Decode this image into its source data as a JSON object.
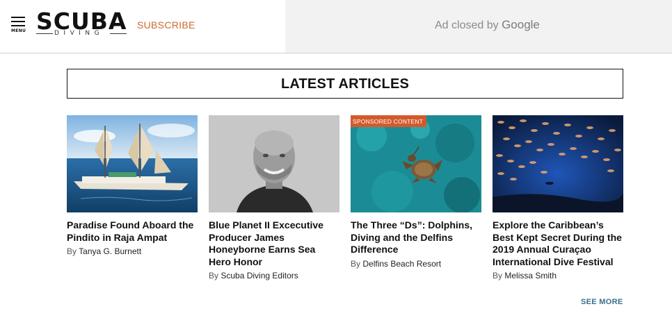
{
  "header": {
    "menu_label": "MENU",
    "logo_text": "SCUBA",
    "logo_sub": "DIVING",
    "subscribe_label": "SUBSCRIBE"
  },
  "ad": {
    "text": "Ad closed by",
    "brand": "Google"
  },
  "section": {
    "title": "LATEST ARTICLES"
  },
  "articles": [
    {
      "title": "Paradise Found Aboard the Pindito in Raja Ampat",
      "by": "By",
      "author": "Tanya G. Burnett",
      "image": "sailing-ship-photo"
    },
    {
      "title": "Blue Planet II Excecutive Producer James Honeyborne Earns Sea Hero Honor",
      "by": "By",
      "author": "Scuba Diving Editors",
      "image": "portrait-photo"
    },
    {
      "title": "The Three “Ds”: Dolphins, Diving and the Delfins Difference",
      "by": "By",
      "author": "Delfins Beach Resort",
      "image": "sea-turtle-photo",
      "badge": "SPONSORED CONTENT"
    },
    {
      "title": "Explore the Caribbean’s Best Kept Secret During the 2019 Annual Curaçao International Dive Festival",
      "by": "By",
      "author": "Melissa Smith",
      "image": "fish-school-photo"
    }
  ],
  "see_more_label": "SEE MORE",
  "colors": {
    "accent": "#c96a2d",
    "badge": "#d35a2b",
    "link": "#3a6f8c"
  }
}
